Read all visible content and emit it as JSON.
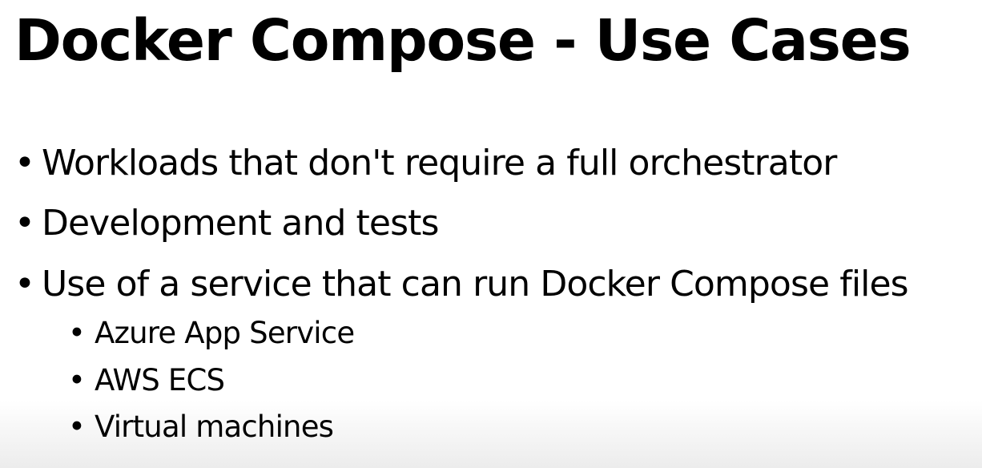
{
  "slide": {
    "title": "Docker Compose - Use Cases",
    "bullet_symbol": "•",
    "bullets": [
      "Workloads that don't require a full orchestrator",
      "Development and tests",
      "Use of a service that can run Docker Compose files"
    ],
    "sub_bullets": [
      "Azure App Service",
      "AWS ECS",
      "Virtual machines"
    ]
  }
}
